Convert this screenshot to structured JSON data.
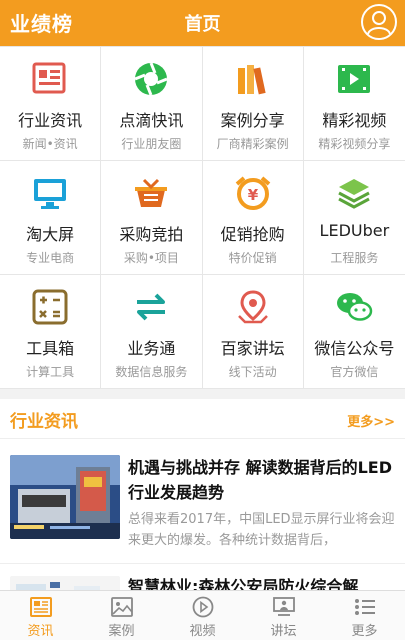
{
  "header": {
    "brand": "业绩榜",
    "title": "首页",
    "avatar_icon": "user-icon"
  },
  "colors": {
    "accent": "#f39c1f",
    "green": "#2db84d",
    "teal": "#1aa39a",
    "red": "#e05a4f"
  },
  "grid": [
    {
      "key": "industry-news",
      "title": "行业资讯",
      "sub": "新闻•资讯",
      "icon": "newspaper-icon"
    },
    {
      "key": "quick-news",
      "title": "点滴快讯",
      "sub": "行业朋友圈",
      "icon": "aperture-icon"
    },
    {
      "key": "case-share",
      "title": "案例分享",
      "sub": "厂商精彩案例",
      "icon": "books-icon"
    },
    {
      "key": "videos",
      "title": "精彩视频",
      "sub": "精彩视频分享",
      "icon": "film-icon"
    },
    {
      "key": "big-screen",
      "title": "淘大屏",
      "sub": "专业电商",
      "icon": "monitor-icon"
    },
    {
      "key": "bidding",
      "title": "采购竞拍",
      "sub": "采购•项目",
      "icon": "basket-icon"
    },
    {
      "key": "promo",
      "title": "促销抢购",
      "sub": "特价促销",
      "icon": "alarm-yen-icon"
    },
    {
      "key": "leduber",
      "title": "LEDUber",
      "sub": "工程服务",
      "icon": "layers-icon"
    },
    {
      "key": "toolbox",
      "title": "工具箱",
      "sub": "计算工具",
      "icon": "calculator-icon"
    },
    {
      "key": "business",
      "title": "业务通",
      "sub": "数据信息服务",
      "icon": "exchange-icon"
    },
    {
      "key": "forum",
      "title": "百家讲坛",
      "sub": "线下活动",
      "icon": "map-pin-icon"
    },
    {
      "key": "wechat",
      "title": "微信公众号",
      "sub": "官方微信",
      "icon": "wechat-icon"
    }
  ],
  "section": {
    "title": "行业资讯",
    "more": "更多>>"
  },
  "news": [
    {
      "title": "机遇与挑战并存 解读数据背后的LED行业发展趋势",
      "desc": "总得来看2017年，中国LED显示屏行业将会迎来更大的爆发。各种统计数据背后，"
    },
    {
      "title": "智慧林业:森林公安局防火综合解",
      "desc": ""
    }
  ],
  "tabs": [
    {
      "label": "资讯",
      "icon": "news-icon",
      "active": true
    },
    {
      "label": "案例",
      "icon": "image-icon",
      "active": false
    },
    {
      "label": "视频",
      "icon": "play-icon",
      "active": false
    },
    {
      "label": "讲坛",
      "icon": "lecture-icon",
      "active": false
    },
    {
      "label": "更多",
      "icon": "list-icon",
      "active": false
    }
  ]
}
